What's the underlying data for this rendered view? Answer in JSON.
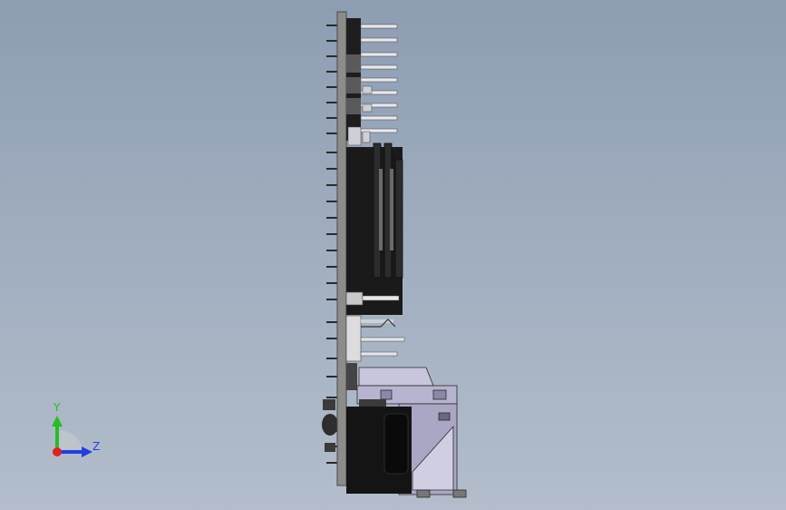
{
  "viewport": {
    "background_top": "#8d9db2",
    "background_bottom": "#b3bdcb"
  },
  "model": {
    "pcb_color": "#8c8c88",
    "component_dark": "#1c1c1c",
    "pin_color": "#e8e8ee",
    "bracket_color": "#b7b4cf"
  },
  "triad": {
    "y_label": "Y",
    "z_label": "Z",
    "y_color": "#22c022",
    "z_color": "#2040e0",
    "x_color": "#e02020"
  }
}
